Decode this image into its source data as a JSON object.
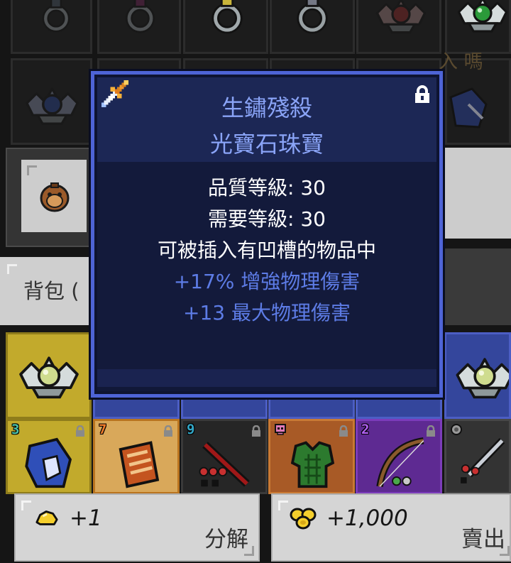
{
  "tooltip": {
    "item_icon": "sword-icon",
    "lock_icon": "lock-icon",
    "item_name": "生鏽殘殺",
    "item_type": "光寶石珠寶",
    "quality_level": "品質等級: 30",
    "required_level": "需要等級: 30",
    "socket_note": "可被插入有凹槽的物品中",
    "mods": [
      "+17% 增強物理傷害",
      "+13 最大物理傷害"
    ],
    "colors": {
      "border": "#4e64d6",
      "title": "#8aa4f7",
      "stat": "#ffffff",
      "mod": "#5d7ce6"
    }
  },
  "inventory": {
    "overlay_text": "入 嗎",
    "bag_tab_label": "背包 (",
    "item_slots_bottom_row": [
      {
        "tier": "3",
        "lock_icon": "lock-icon"
      },
      {
        "tier": "7",
        "lock_icon": "lock-icon"
      },
      {
        "tier": "9",
        "lock_icon": "lock-icon"
      },
      {
        "badge_icon": "skull-icon",
        "lock_icon": "lock-icon"
      },
      {
        "tier": "2",
        "lock_icon": "lock-icon"
      },
      {
        "badge_icon": "gem-icon"
      }
    ]
  },
  "actions": {
    "salvage": {
      "icon": "gold-nugget-icon",
      "amount": "+1",
      "label": "分解"
    },
    "sell": {
      "icon": "gold-coins-icon",
      "amount": "+1,000",
      "label": "賣出"
    }
  }
}
